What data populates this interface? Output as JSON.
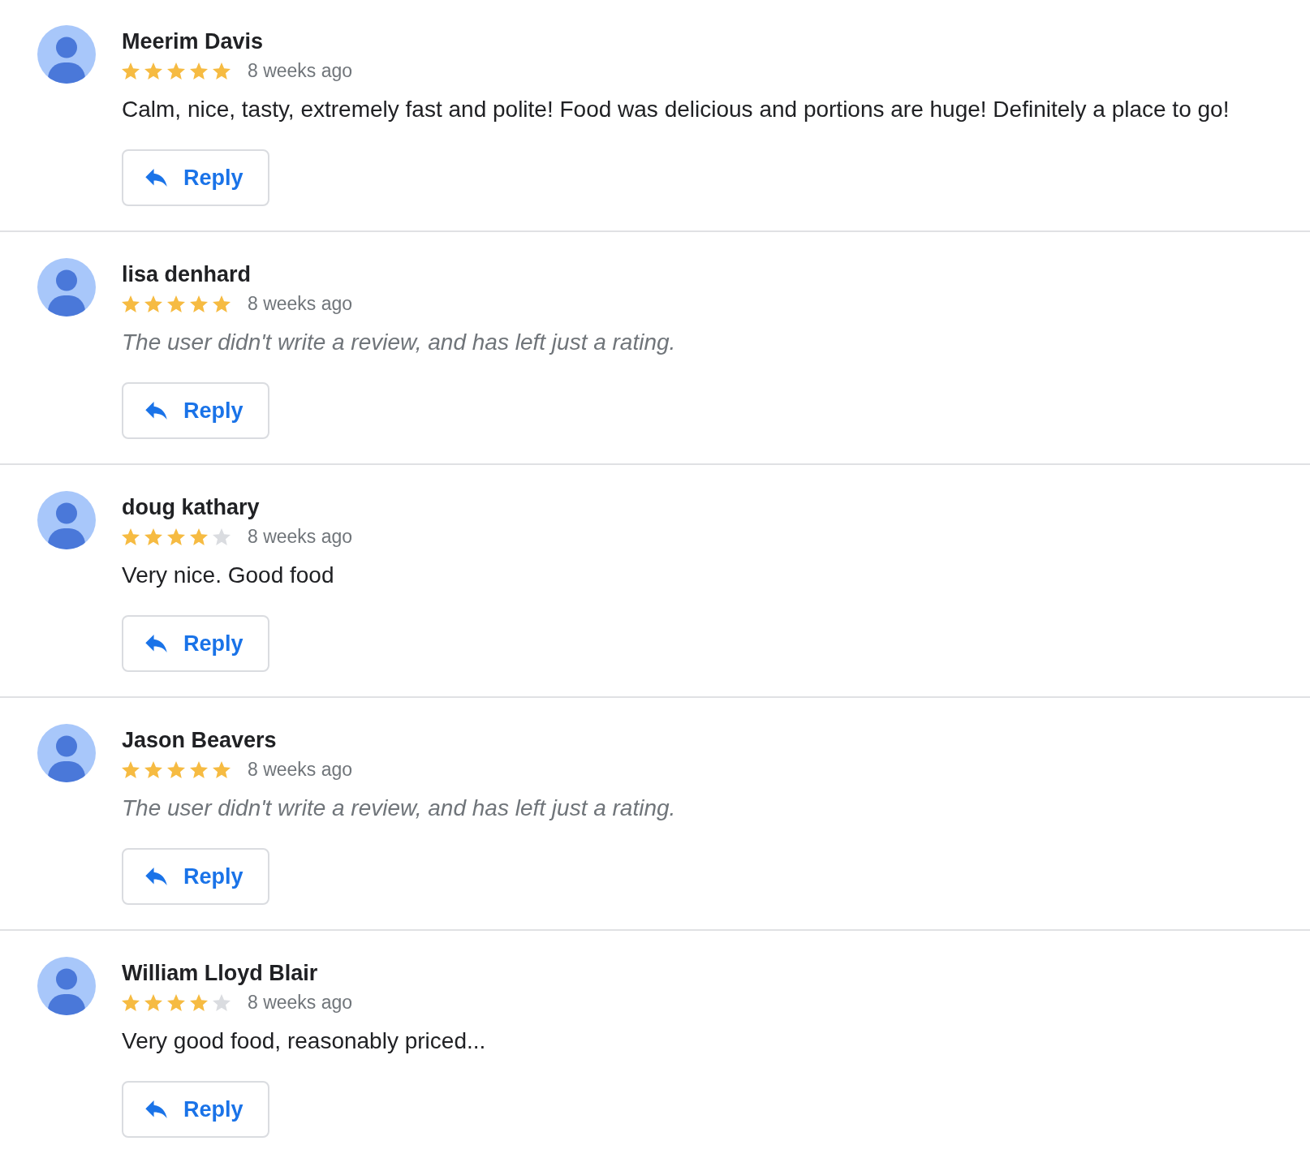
{
  "reviews": [
    {
      "author": "Meerim Davis",
      "stars": 5,
      "time": "8 weeks ago",
      "kind": "text",
      "text": "Calm, nice, tasty, extremely fast and polite! Food was delicious and portions are huge! Definitely a place to go!",
      "reply_button": "Reply"
    },
    {
      "author": "lisa denhard",
      "stars": 5,
      "time": "8 weeks ago",
      "kind": "rating_only",
      "text": "The user didn't write a review, and has left just a rating.",
      "reply_button": "Reply"
    },
    {
      "author": "doug kathary",
      "stars": 4,
      "time": "8 weeks ago",
      "kind": "text",
      "text": "Very nice. Good food",
      "reply_button": "Reply"
    },
    {
      "author": "Jason Beavers",
      "stars": 5,
      "time": "8 weeks ago",
      "kind": "rating_only",
      "text": "The user didn't write a review, and has left just a rating.",
      "reply_button": "Reply"
    },
    {
      "author": "William Lloyd Blair",
      "stars": 4,
      "time": "8 weeks ago",
      "kind": "text",
      "text": "Very good food, reasonably priced...",
      "reply_button": "Reply"
    }
  ]
}
